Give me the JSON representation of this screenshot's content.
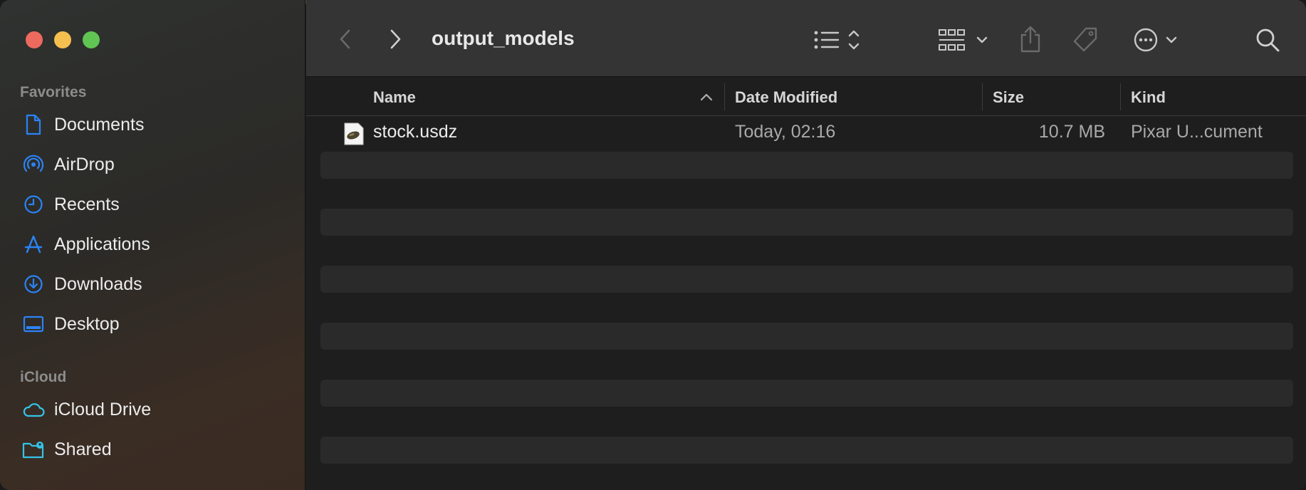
{
  "window": {
    "title": "output_models"
  },
  "sidebar": {
    "sections": [
      {
        "label": "Favorites",
        "items": [
          {
            "label": "Documents",
            "icon": "document-icon"
          },
          {
            "label": "AirDrop",
            "icon": "airdrop-icon"
          },
          {
            "label": "Recents",
            "icon": "clock-icon"
          },
          {
            "label": "Applications",
            "icon": "applications-icon"
          },
          {
            "label": "Downloads",
            "icon": "download-icon"
          },
          {
            "label": "Desktop",
            "icon": "desktop-icon"
          }
        ]
      },
      {
        "label": "iCloud",
        "items": [
          {
            "label": "iCloud Drive",
            "icon": "cloud-icon"
          },
          {
            "label": "Shared",
            "icon": "shared-folder-icon"
          }
        ]
      }
    ]
  },
  "columns": {
    "name": "Name",
    "date_modified": "Date Modified",
    "size": "Size",
    "kind": "Kind"
  },
  "files": [
    {
      "name": "stock.usdz",
      "date_modified": "Today, 02:16",
      "size": "10.7 MB",
      "kind": "Pixar U...cument"
    }
  ],
  "colors": {
    "accent": "#2b83f6",
    "icloud_accent": "#35c3e6"
  }
}
